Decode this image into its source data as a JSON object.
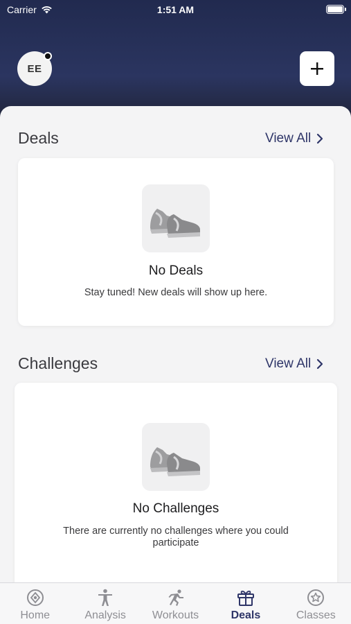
{
  "status_bar": {
    "carrier": "Carrier",
    "time": "1:51 AM"
  },
  "header": {
    "avatar_initials": "EE",
    "add_label": "+"
  },
  "deals": {
    "title": "Deals",
    "view_all": "View All",
    "empty_title": "No Deals",
    "empty_subtitle": "Stay tuned! New deals will show up here."
  },
  "challenges": {
    "title": "Challenges",
    "view_all": "View All",
    "empty_title": "No Challenges",
    "empty_subtitle": "There are currently no challenges where you could participate"
  },
  "tabs": [
    {
      "label": "Home",
      "icon": "target-icon",
      "active": false
    },
    {
      "label": "Analysis",
      "icon": "person-icon",
      "active": false
    },
    {
      "label": "Workouts",
      "icon": "running-icon",
      "active": false
    },
    {
      "label": "Deals",
      "icon": "gift-icon",
      "active": true
    },
    {
      "label": "Classes",
      "icon": "star-circle-icon",
      "active": false
    }
  ],
  "colors": {
    "accent": "#2e3568",
    "header_top": "#212a4f",
    "inactive_tab": "#8e8e93"
  }
}
